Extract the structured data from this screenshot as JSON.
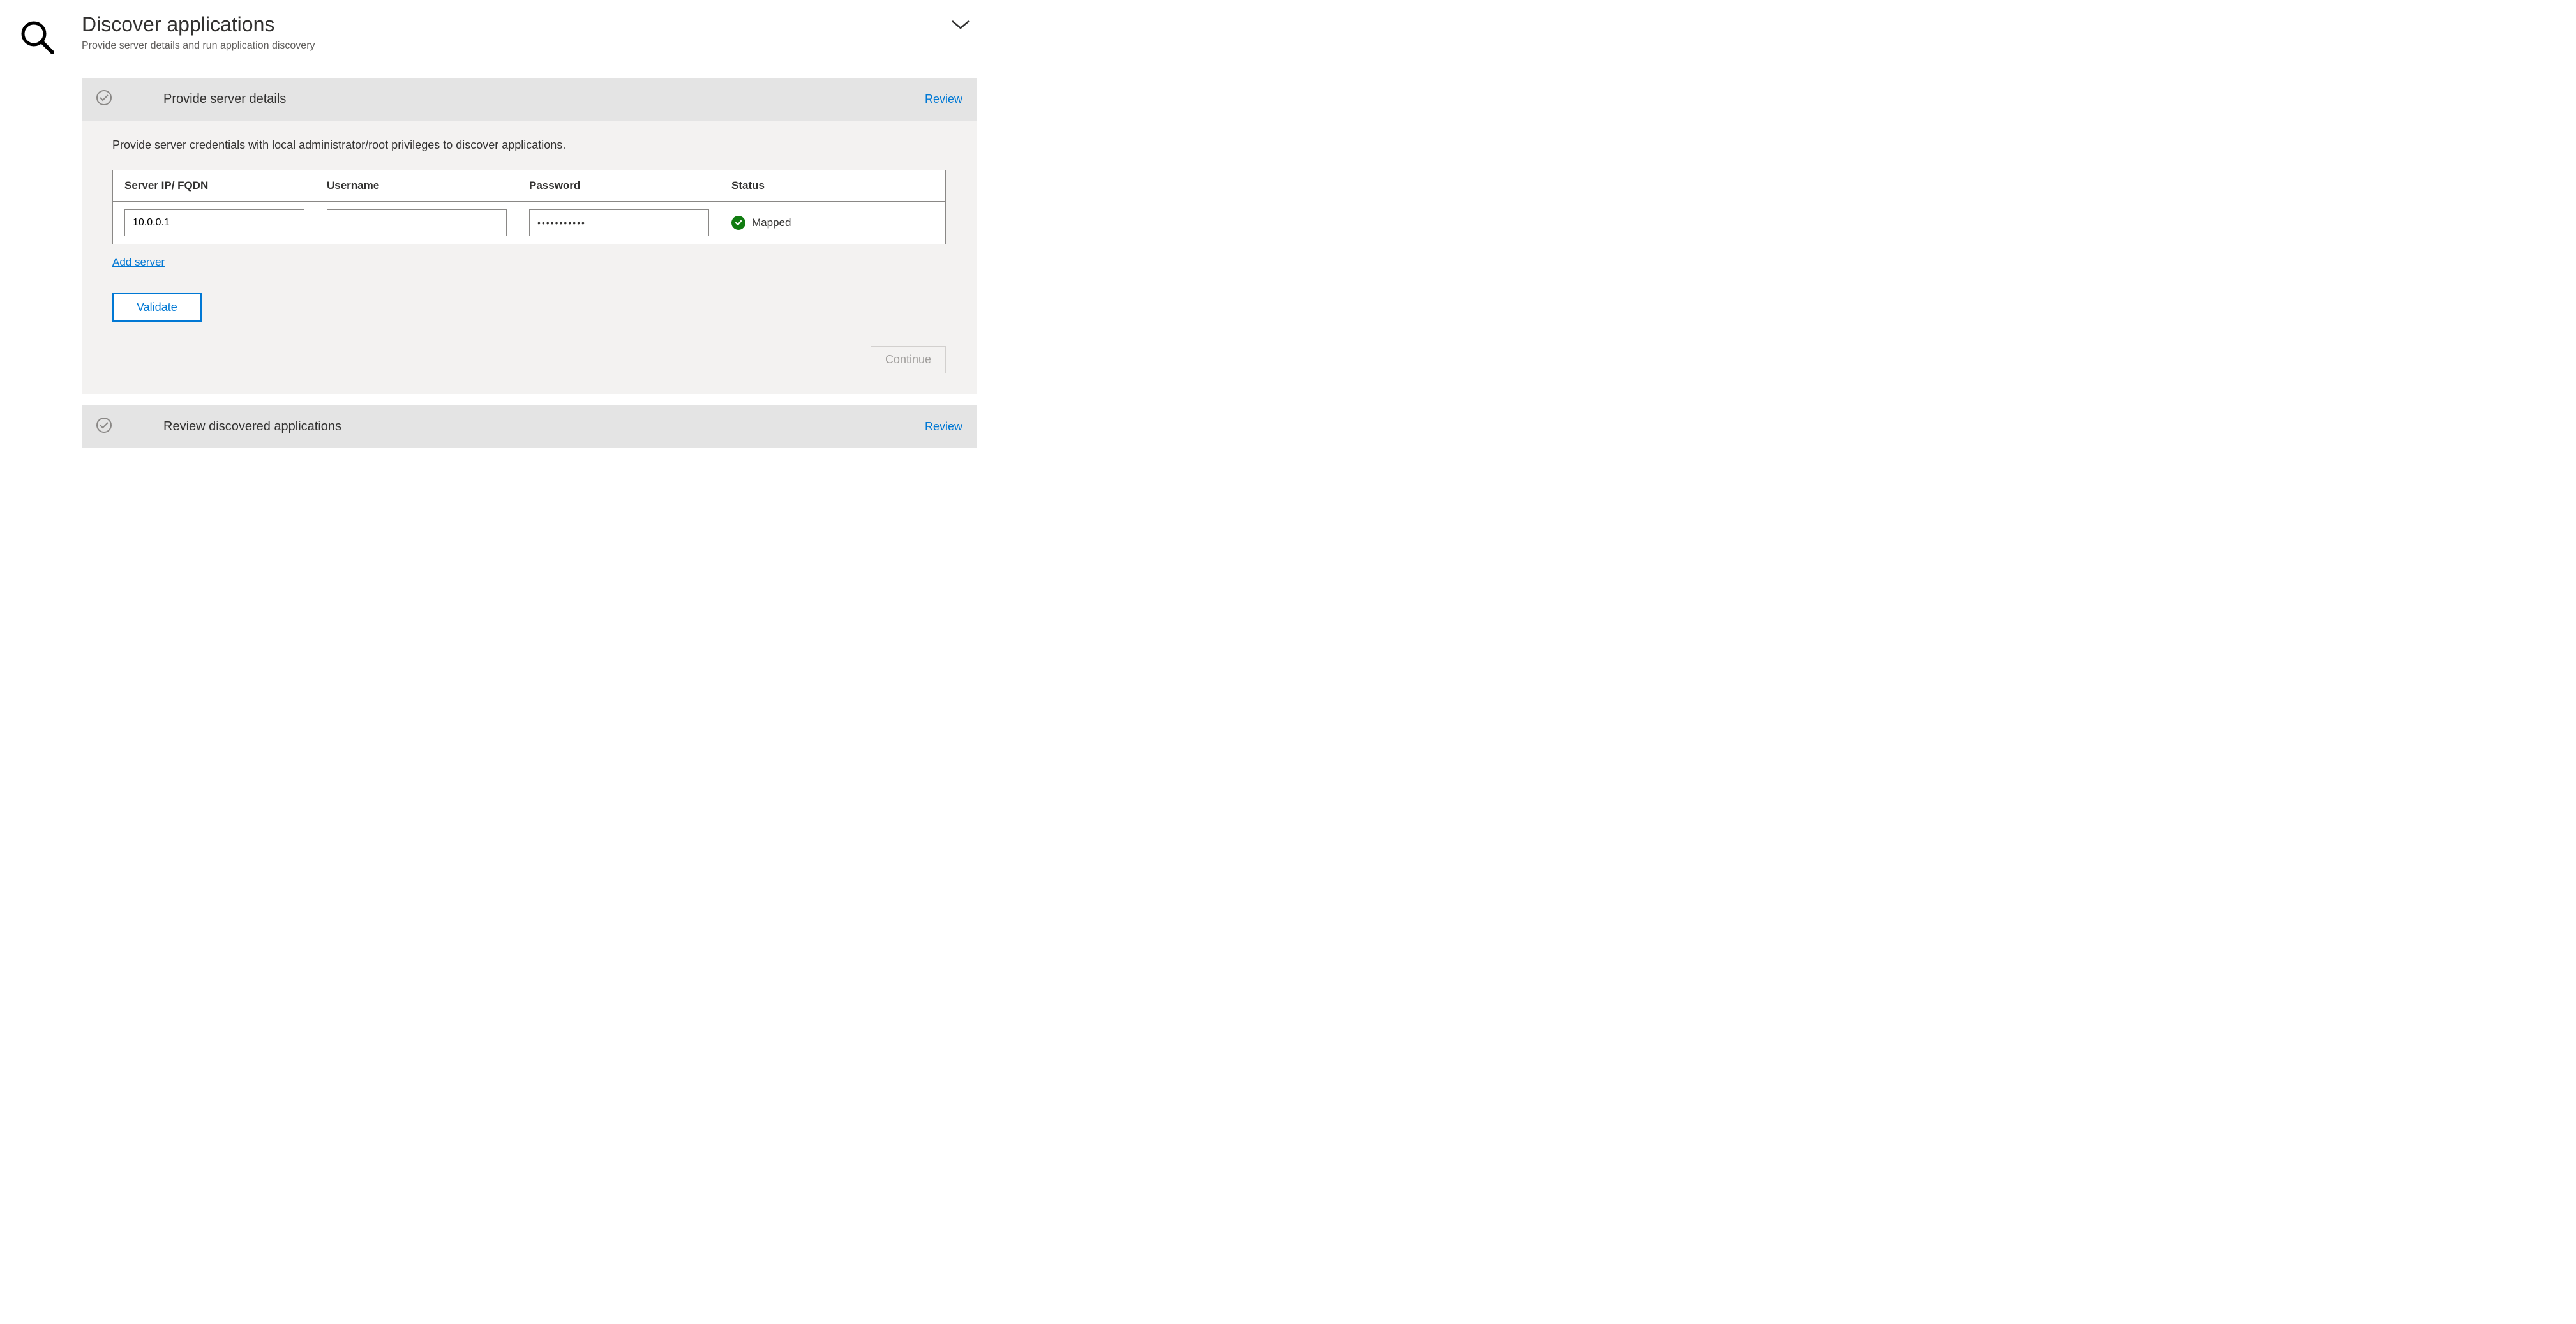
{
  "header": {
    "title": "Discover applications",
    "subtitle": "Provide server details and run application discovery"
  },
  "section1": {
    "title": "Provide server details",
    "review_link": "Review",
    "instruction": "Provide server credentials with local administrator/root privileges to discover applications.",
    "columns": {
      "ip": "Server IP/ FQDN",
      "username": "Username",
      "password": "Password",
      "status": "Status"
    },
    "row": {
      "ip_value": "10.0.0.1",
      "username_value": "",
      "password_display": "•••••••••••",
      "status_label": "Mapped"
    },
    "add_server": "Add server",
    "validate": "Validate",
    "continue": "Continue"
  },
  "section2": {
    "title": "Review discovered applications",
    "review_link": "Review"
  }
}
